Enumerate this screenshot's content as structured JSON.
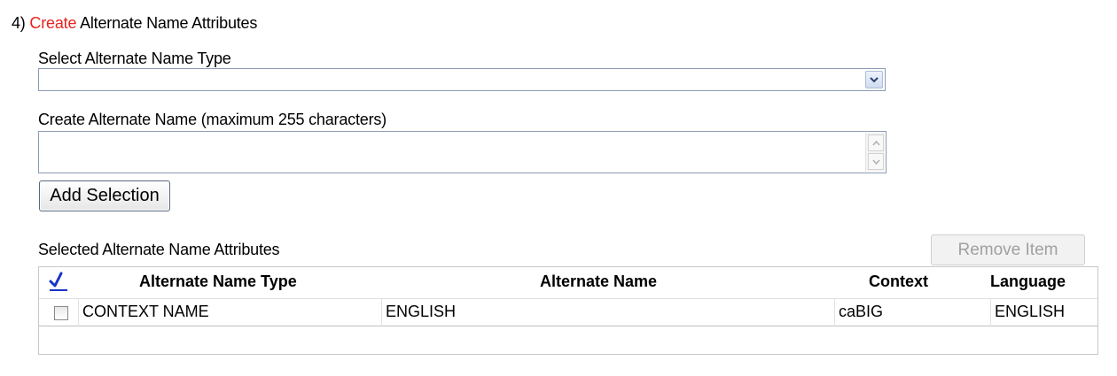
{
  "section": {
    "number": "4)",
    "action": "Create",
    "title": "Alternate Name Attributes"
  },
  "type_select": {
    "label": "Select Alternate Name Type",
    "value": ""
  },
  "name_input": {
    "label": "Create Alternate Name (maximum 255 characters)",
    "value": ""
  },
  "add_button": {
    "label": "Add Selection"
  },
  "selected": {
    "label": "Selected Alternate Name Attributes",
    "remove_button": "Remove Item",
    "columns": [
      "Alternate Name Type",
      "Alternate Name",
      "Context",
      "Language"
    ],
    "rows": [
      {
        "checked": false,
        "type": "CONTEXT NAME",
        "name": "ENGLISH",
        "context": "caBIG",
        "language": "ENGLISH"
      }
    ]
  },
  "colors": {
    "accent_red": "#e8231e",
    "check_blue": "#1a33c8"
  }
}
